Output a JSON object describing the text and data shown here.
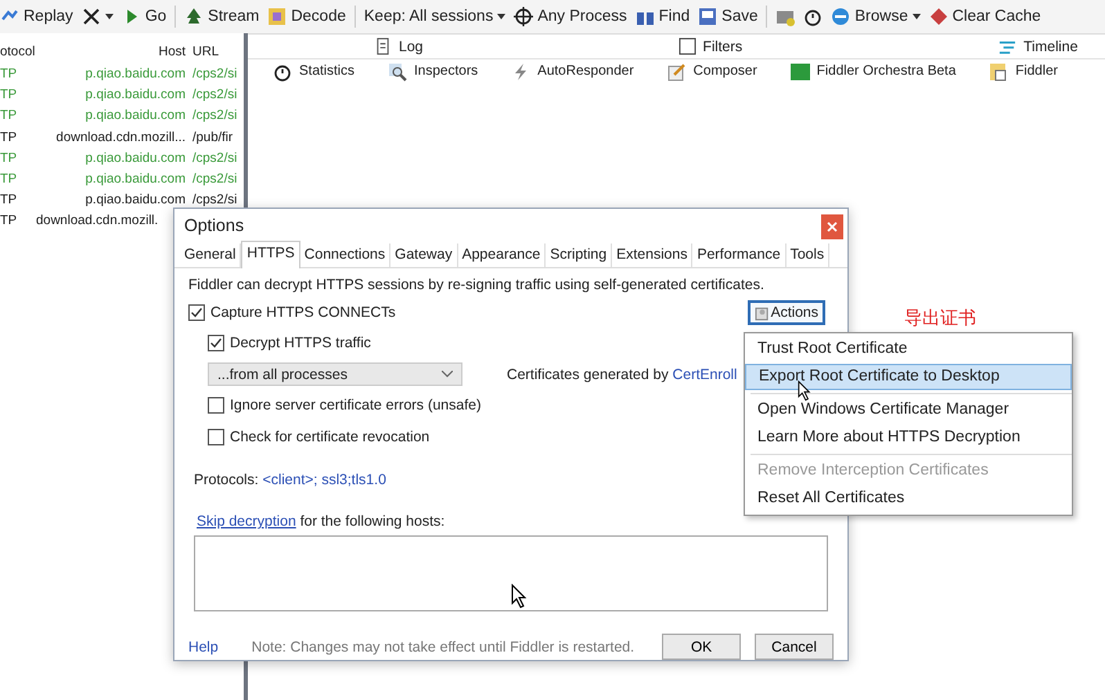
{
  "toolbar": {
    "items": [
      {
        "kind": "button",
        "label": "Replay"
      },
      {
        "kind": "dropdown"
      },
      {
        "kind": "button",
        "label": "Go"
      },
      {
        "kind": "separator"
      },
      {
        "kind": "button",
        "label": "Stream"
      },
      {
        "kind": "button",
        "label": "Decode"
      },
      {
        "kind": "separator"
      },
      {
        "kind": "dropdown",
        "label": "Keep: All sessions"
      },
      {
        "kind": "button",
        "label": "Any Process"
      },
      {
        "kind": "button",
        "label": "Find"
      },
      {
        "kind": "button",
        "label": "Save"
      },
      {
        "kind": "separator"
      },
      {
        "kind": "button"
      },
      {
        "kind": "button"
      },
      {
        "kind": "dropdown",
        "label": "Browse"
      },
      {
        "kind": "button",
        "label": "Clear Cache"
      }
    ]
  },
  "sessions": {
    "columns": [
      "otocol",
      "Host",
      "URL"
    ],
    "rows": [
      {
        "protocol": "TP",
        "host": "p.qiao.baidu.com",
        "url": "/cps2/si",
        "color": "#3a9a3a"
      },
      {
        "protocol": "TP",
        "host": "p.qiao.baidu.com",
        "url": "/cps2/si",
        "color": "#3a9a3a"
      },
      {
        "protocol": "TP",
        "host": "p.qiao.baidu.com",
        "url": "/cps2/si",
        "color": "#3a9a3a"
      },
      {
        "protocol": "TP",
        "host": "download.cdn.mozill...",
        "url": "/pub/fir",
        "color": "#202020"
      },
      {
        "protocol": "TP",
        "host": "p.qiao.baidu.com",
        "url": "/cps2/si",
        "color": "#3a9a3a"
      },
      {
        "protocol": "TP",
        "host": "p.qiao.baidu.com",
        "url": "/cps2/si",
        "color": "#3a9a3a"
      },
      {
        "protocol": "TP",
        "host": "p.qiao.baidu.com",
        "url": "/cps2/si",
        "color": "#202020"
      },
      {
        "protocol": "TP",
        "host": "download.cdn.mozill.",
        "color": "#202020"
      }
    ]
  },
  "inspector_tabs": {
    "top": [
      {
        "label": "Log"
      },
      {
        "label": "Filters"
      },
      {
        "label": "Timeline"
      }
    ],
    "bottom": [
      {
        "label": "Statistics"
      },
      {
        "label": "Inspectors"
      },
      {
        "label": "AutoResponder"
      },
      {
        "label": "Composer"
      },
      {
        "label": "Fiddler Orchestra Beta"
      },
      {
        "label": "Fiddler"
      }
    ]
  },
  "dialog": {
    "title": "Options",
    "tabs": [
      {
        "label": "General",
        "selected": false
      },
      {
        "label": "HTTPS",
        "selected": true
      },
      {
        "label": "Connections",
        "selected": false
      },
      {
        "label": "Gateway",
        "selected": false
      },
      {
        "label": "Appearance",
        "selected": false
      },
      {
        "label": "Scripting",
        "selected": false
      },
      {
        "label": "Extensions",
        "selected": false
      },
      {
        "label": "Performance",
        "selected": false
      },
      {
        "label": "Tools",
        "selected": false
      }
    ],
    "description": "Fiddler can decrypt HTTPS sessions by re-signing traffic using self-generated certificates.",
    "capture_connects": {
      "label": "Capture HTTPS CONNECTs",
      "checked": true
    },
    "decrypt_traffic": {
      "label": "Decrypt HTTPS traffic",
      "checked": true
    },
    "process_filter": {
      "value": "...from all processes"
    },
    "certificates_note": {
      "text": "Certificates generated by",
      "link": "CertEnroll"
    },
    "ignore_errors": {
      "label": "Ignore server certificate errors (unsafe)",
      "checked": false
    },
    "check_revocation": {
      "label": "Check for certificate revocation",
      "checked": false
    },
    "protocols": {
      "label": "Protocols:",
      "value": "<client>; ssl3;tls1.0"
    },
    "skip": {
      "link": "Skip decryption",
      "text": "for the following hosts:"
    },
    "actions_button": "Actions",
    "footer": {
      "help": "Help",
      "note": "Note: Changes may not take effect until Fiddler is restarted.",
      "ok": "OK",
      "cancel": "Cancel"
    }
  },
  "actions_menu": {
    "groups": [
      [
        {
          "label": "Trust Root Certificate",
          "selected": false,
          "disabled": false
        },
        {
          "label": "Export Root Certificate to Desktop",
          "selected": true,
          "disabled": false
        }
      ],
      [
        {
          "label": "Open Windows Certificate Manager",
          "selected": false,
          "disabled": false
        },
        {
          "label": "Learn More about HTTPS Decryption",
          "selected": false,
          "disabled": false
        }
      ],
      [
        {
          "label": "Remove Interception Certificates",
          "selected": false,
          "disabled": true
        },
        {
          "label": "Reset All Certificates",
          "selected": false,
          "disabled": false
        }
      ]
    ]
  },
  "annotation": "导出证书"
}
